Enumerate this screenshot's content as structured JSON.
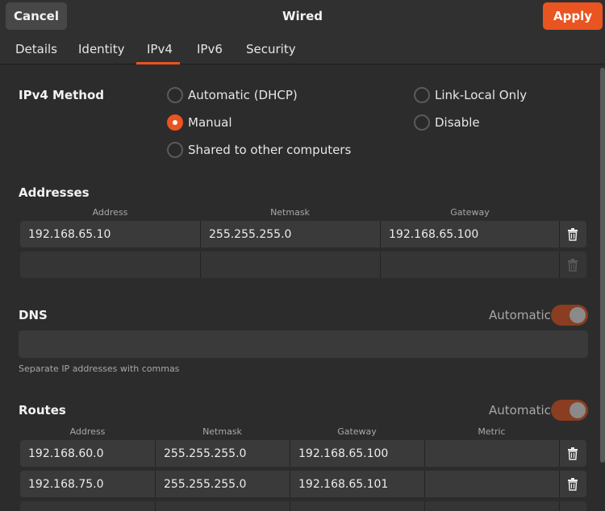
{
  "header": {
    "title": "Wired",
    "cancel_label": "Cancel",
    "apply_label": "Apply"
  },
  "tabs": [
    {
      "label": "Details"
    },
    {
      "label": "Identity"
    },
    {
      "label": "IPv4"
    },
    {
      "label": "IPv6"
    },
    {
      "label": "Security"
    }
  ],
  "ipv4_method": {
    "label": "IPv4 Method",
    "options": [
      {
        "label": "Automatic (DHCP)",
        "selected": false
      },
      {
        "label": "Link-Local Only",
        "selected": false
      },
      {
        "label": "Manual",
        "selected": true
      },
      {
        "label": "Disable",
        "selected": false
      },
      {
        "label": "Shared to other computers",
        "selected": false
      }
    ]
  },
  "addresses": {
    "label": "Addresses",
    "columns": [
      "Address",
      "Netmask",
      "Gateway"
    ],
    "rows": [
      [
        "192.168.65.10",
        "255.255.255.0",
        "192.168.65.100"
      ],
      [
        "",
        "",
        ""
      ]
    ]
  },
  "dns": {
    "label": "DNS",
    "automatic_label": "Automatic",
    "automatic_on": true,
    "value": "",
    "hint": "Separate IP addresses with commas"
  },
  "routes": {
    "label": "Routes",
    "automatic_label": "Automatic",
    "automatic_on": true,
    "columns": [
      "Address",
      "Netmask",
      "Gateway",
      "Metric"
    ],
    "rows": [
      [
        "192.168.60.0",
        "255.255.255.0",
        "192.168.65.100",
        ""
      ],
      [
        "192.168.75.0",
        "255.255.255.0",
        "192.168.65.101",
        ""
      ]
    ]
  },
  "colors": {
    "accent": "#e95420",
    "background": "#2c2c2c"
  }
}
